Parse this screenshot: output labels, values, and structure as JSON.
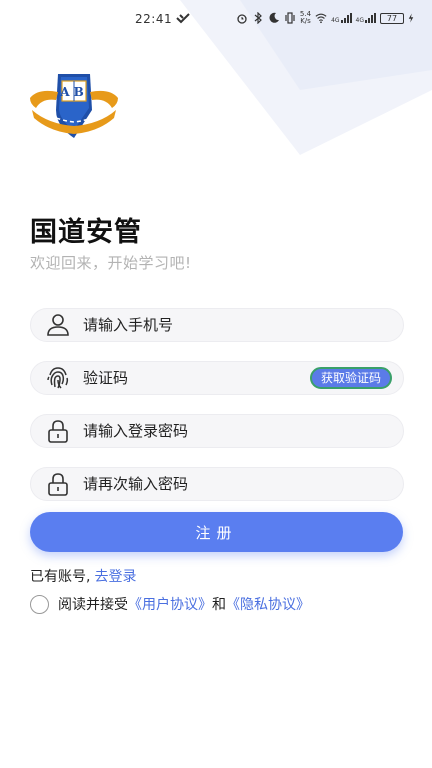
{
  "status_bar": {
    "time": "22:41",
    "net_speed_value": "5.4",
    "net_speed_unit": "K/s",
    "sig1_label": "4G",
    "sig2_label": "4G",
    "battery": "77"
  },
  "app": {
    "title": "国道安管",
    "subtitle": "欢迎回来，开始学习吧!"
  },
  "logo": {
    "text": "AB"
  },
  "form": {
    "phone_placeholder": "请输入手机号",
    "code_placeholder": "验证码",
    "get_code_label": "获取验证码",
    "password_placeholder": "请输入登录密码",
    "confirm_placeholder": "请再次输入密码",
    "register_label": "注册"
  },
  "login": {
    "prompt": "已有账号,",
    "link": "去登录"
  },
  "agreement": {
    "prefix": "阅读并接受",
    "user_agreement": "《用户协议》",
    "and": "和",
    "privacy_policy": "《隐私协议》"
  },
  "colors": {
    "accent": "#5a7ef0",
    "link": "#4a6fe0",
    "field_bg": "#f6f6f8"
  }
}
